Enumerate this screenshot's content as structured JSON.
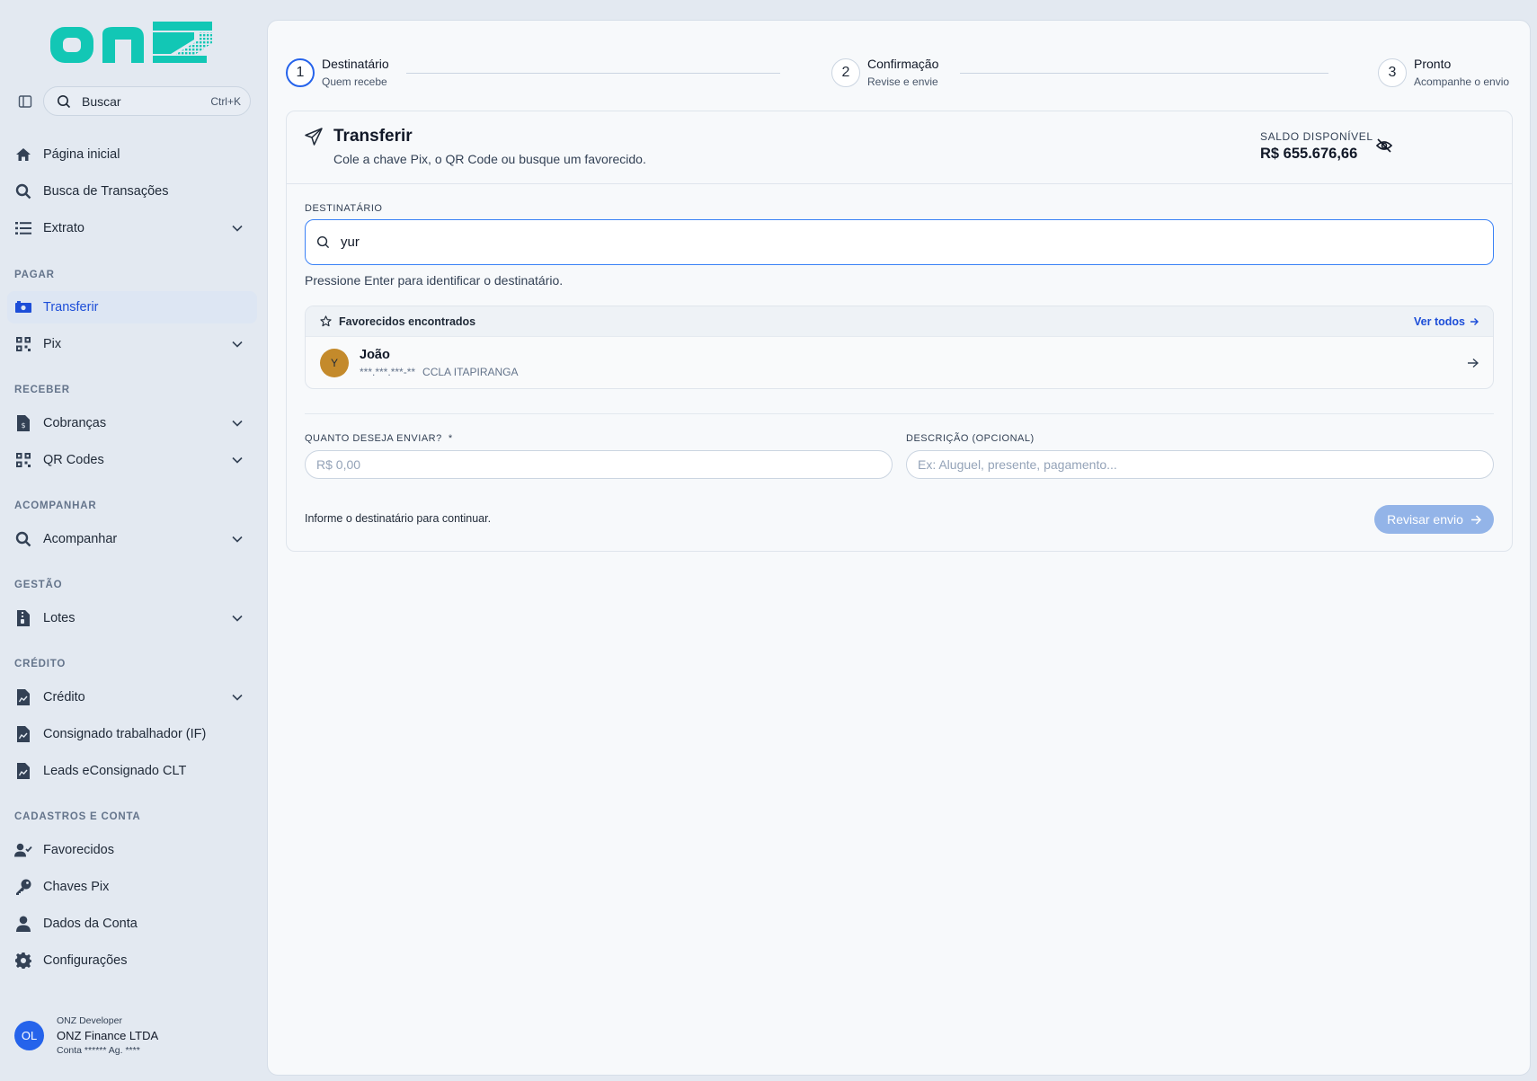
{
  "brand": {
    "logo_text": "onz",
    "accent": "#12c7b5"
  },
  "sidebar": {
    "search": {
      "label": "Buscar",
      "shortcut": "Ctrl+K"
    },
    "top_items": [
      {
        "label": "Página inicial",
        "icon": "home-icon"
      },
      {
        "label": "Busca de Transações",
        "icon": "search-icon"
      },
      {
        "label": "Extrato",
        "icon": "list-icon"
      }
    ],
    "sections": {
      "pagar": "PAGAR",
      "receber": "RECEBER",
      "acompanhar": "ACOMPANHAR",
      "gestao": "GESTÃO",
      "credito": "CRÉDITO",
      "cadastros": "CADASTROS E CONTA"
    },
    "pagar_items": [
      {
        "label": "Transferir",
        "icon": "money-transfer-icon",
        "active": true
      },
      {
        "label": "Pix",
        "icon": "qr-grid-icon"
      }
    ],
    "receber_items": [
      {
        "label": "Cobranças",
        "icon": "invoice-icon"
      },
      {
        "label": "QR Codes",
        "icon": "qr-grid-icon"
      }
    ],
    "acompanhar_items": [
      {
        "label": "Acompanhar",
        "icon": "search-icon"
      }
    ],
    "gestao_items": [
      {
        "label": "Lotes",
        "icon": "file-zip-icon"
      }
    ],
    "credito_items": [
      {
        "label": "Crédito",
        "icon": "file-chart-icon"
      },
      {
        "label": "Consignado trabalhador (IF)",
        "icon": "file-chart-icon"
      },
      {
        "label": "Leads eConsignado CLT",
        "icon": "file-chart-icon"
      }
    ],
    "cadastros_items": [
      {
        "label": "Favorecidos",
        "icon": "user-check-icon"
      },
      {
        "label": "Chaves Pix",
        "icon": "key-icon"
      },
      {
        "label": "Dados da Conta",
        "icon": "user-icon"
      },
      {
        "label": "Configurações",
        "icon": "gear-icon"
      }
    ],
    "user": {
      "initials": "OL",
      "role": "ONZ Developer",
      "company": "ONZ Finance LTDA",
      "account": "Conta ****** Ag. ****"
    }
  },
  "stepper": [
    {
      "number": "1",
      "title": "Destinatário",
      "subtitle": "Quem recebe",
      "current": true
    },
    {
      "number": "2",
      "title": "Confirmação",
      "subtitle": "Revise e envie"
    },
    {
      "number": "3",
      "title": "Pronto",
      "subtitle": "Acompanhe o envio"
    }
  ],
  "card": {
    "title": "Transferir",
    "subtitle": "Cole a chave Pix, o QR Code ou busque um favorecido.",
    "balance_label": "SALDO DISPONÍVEL",
    "balance_value": "R$ 655.676,66",
    "recipient_label": "DESTINATÁRIO",
    "recipient_value": "yur",
    "hint": "Pressione Enter para identificar o destinatário.",
    "favorites": {
      "header": "Favorecidos encontrados",
      "see_all": "Ver todos",
      "items": [
        {
          "initial": "Y",
          "name": "João",
          "document": "***.***.***-**",
          "bank": "CCLA ITAPIRANGA"
        }
      ]
    },
    "amount_label": "QUANTO DESEJA ENVIAR?",
    "amount_required": "*",
    "amount_placeholder": "R$ 0,00",
    "description_label": "DESCRIÇÃO (OPCIONAL)",
    "description_placeholder": "Ex: Aluguel, presente, pagamento...",
    "footer_message": "Informe o destinatário para continuar.",
    "review_button": "Revisar envio"
  }
}
